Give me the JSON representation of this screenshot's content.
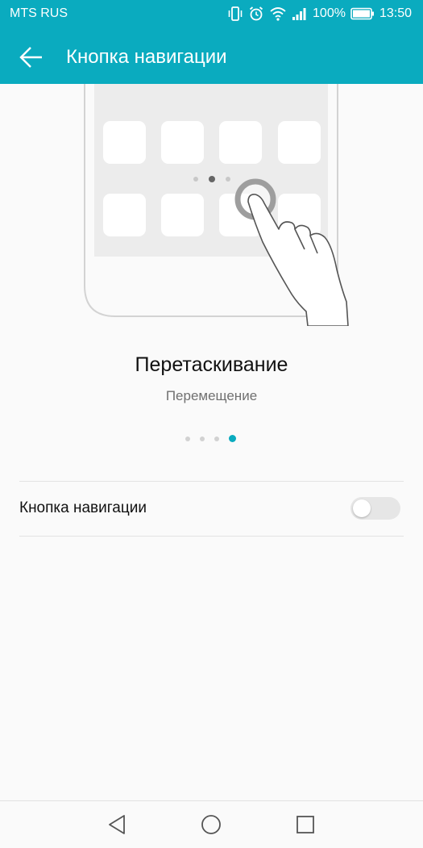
{
  "status_bar": {
    "carrier": "MTS RUS",
    "battery": "100%",
    "time": "13:50",
    "icons": [
      "vibrate-icon",
      "alarm-icon",
      "wifi-icon",
      "signal-icon",
      "battery-icon"
    ]
  },
  "toolbar": {
    "title": "Кнопка навигации",
    "back_icon": "arrow-left-icon"
  },
  "illustration": {
    "description_icons": [
      "phone-frame",
      "app-icons",
      "nav-button-circle",
      "hand-pointer-icon"
    ]
  },
  "gesture": {
    "title": "Перетаскивание",
    "subtitle": "Перемещение"
  },
  "pager": {
    "count": 4,
    "active": 4
  },
  "setting": {
    "label": "Кнопка навигации",
    "enabled": false
  },
  "colors": {
    "accent": "#0aabbf",
    "background": "#fafafa"
  },
  "navigation_bar": [
    "back-triangle-icon",
    "home-circle-icon",
    "recents-square-icon"
  ]
}
